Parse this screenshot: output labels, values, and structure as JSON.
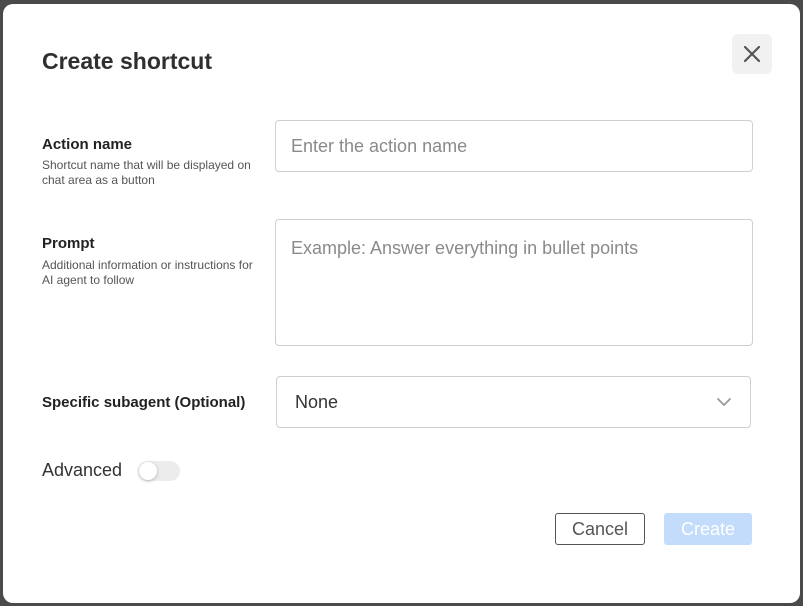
{
  "dialog": {
    "title": "Create shortcut",
    "close_icon": "close-icon"
  },
  "action_name": {
    "label": "Action name",
    "help": "Shortcut name that will be displayed on chat area as a button",
    "value": "",
    "placeholder": "Enter the action name"
  },
  "prompt": {
    "label": "Prompt",
    "help": "Additional information or instructions for AI agent to follow",
    "value": "",
    "placeholder": "Example: Answer everything in bullet points"
  },
  "subagent": {
    "label": "Specific subagent (Optional)",
    "selected": "None",
    "icon": "chevron-down-icon"
  },
  "advanced": {
    "label": "Advanced",
    "enabled": false
  },
  "buttons": {
    "cancel": "Cancel",
    "create": "Create"
  },
  "colors": {
    "create_button_bg": "#c3dcfc",
    "toggle_track": "#ececec"
  }
}
